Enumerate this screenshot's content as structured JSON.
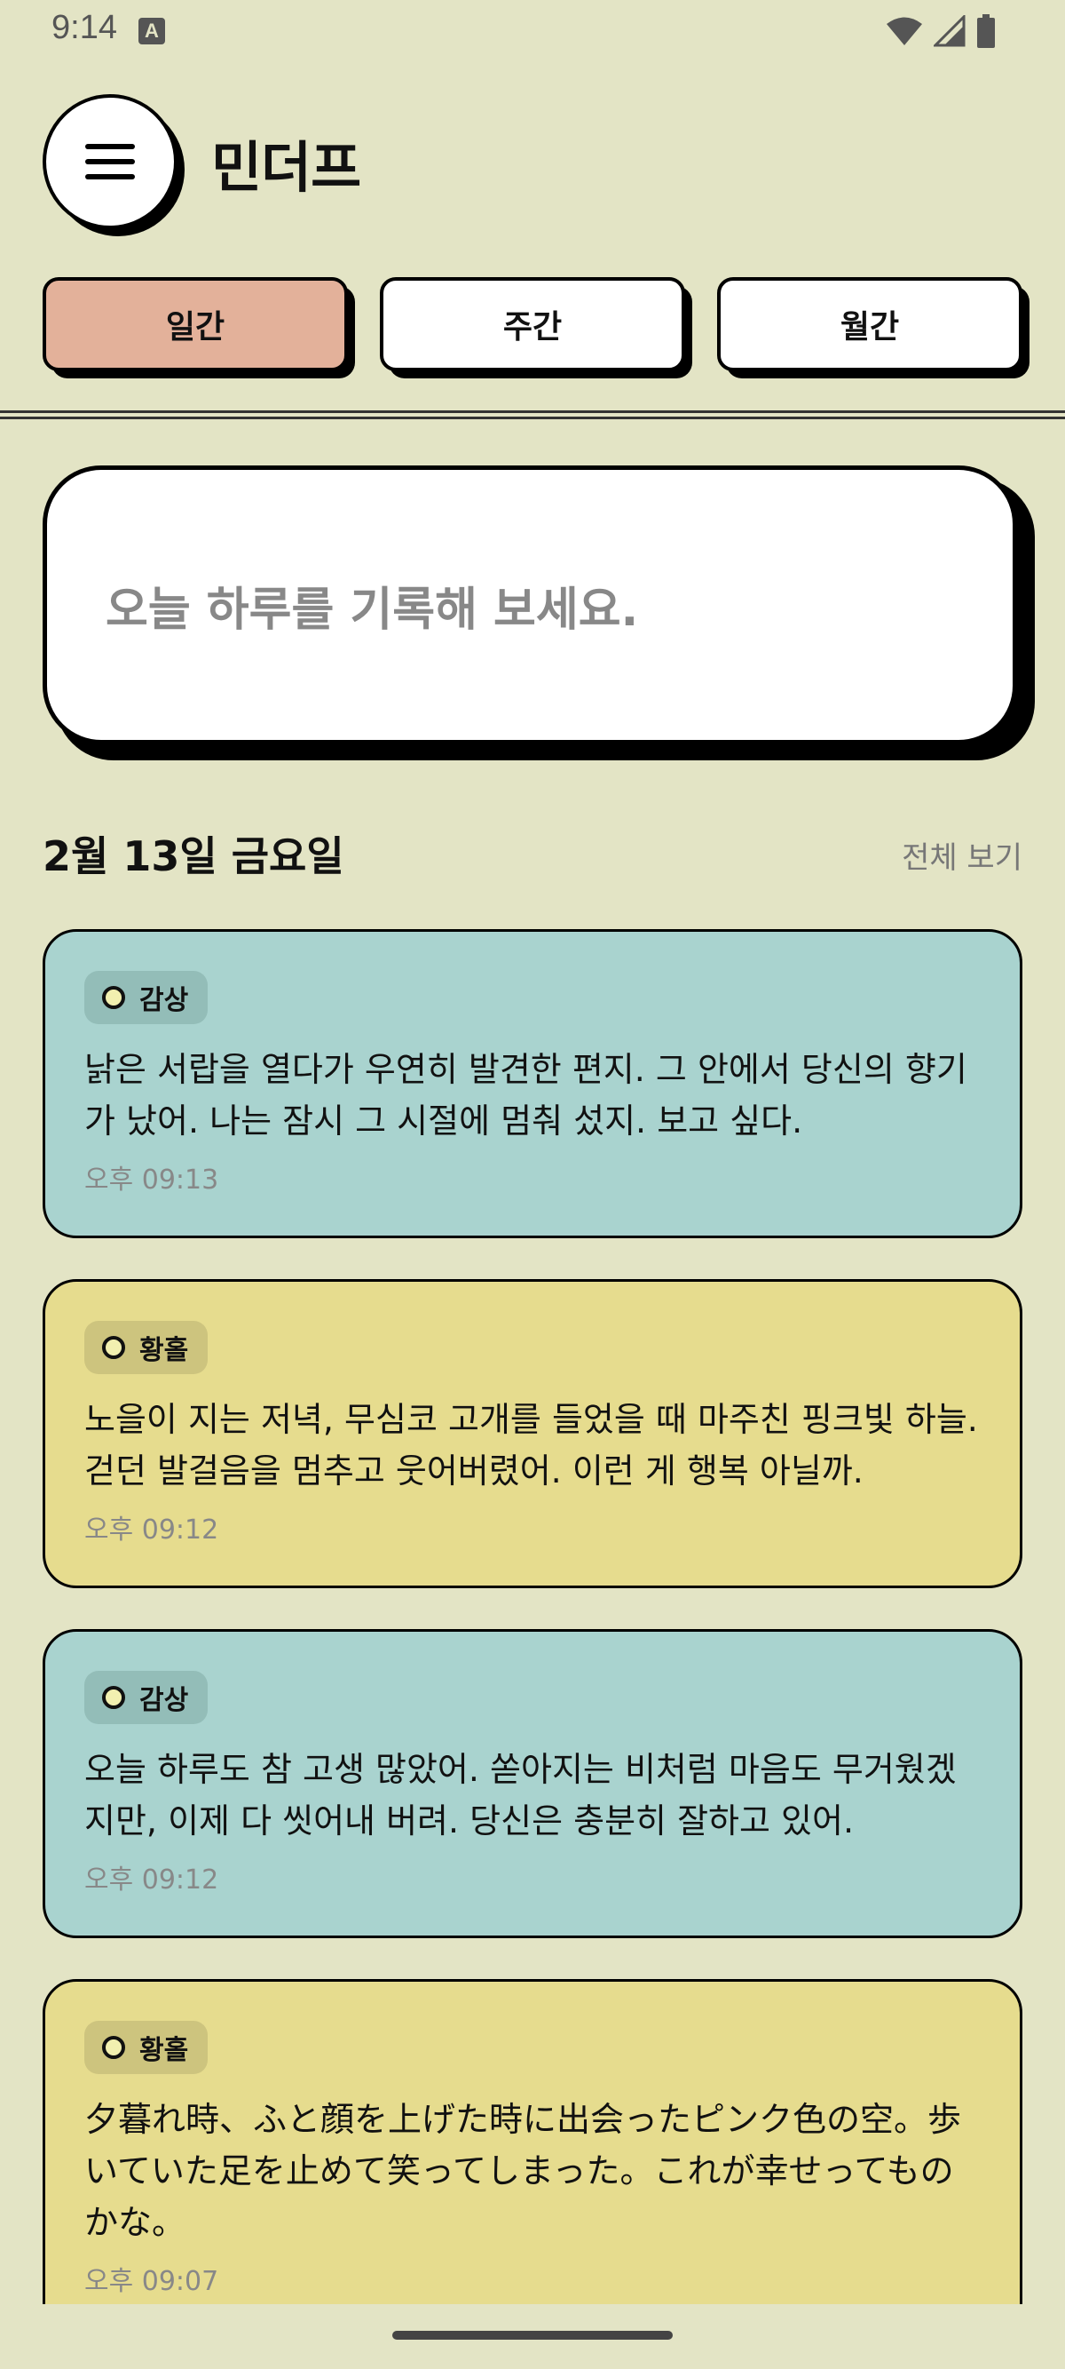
{
  "status_bar": {
    "time": "9:14",
    "notification_badge": "A"
  },
  "header": {
    "title": "민더프"
  },
  "tabs": [
    {
      "label": "일간",
      "active": true
    },
    {
      "label": "주간",
      "active": false
    },
    {
      "label": "월간",
      "active": false
    }
  ],
  "record": {
    "placeholder": "오늘 하루를 기록해 보세요."
  },
  "section": {
    "date": "2월 13일 금요일",
    "view_all": "전체 보기"
  },
  "entries": [
    {
      "tag": "감상",
      "color": "blue",
      "text": "낡은 서랍을 열다가 우연히 발견한 편지. 그 안에서 당신의 향기가 났어. 나는 잠시 그 시절에 멈춰 섰지. 보고 싶다.",
      "time": "오후 09:13"
    },
    {
      "tag": "황홀",
      "color": "yellow",
      "text": "노을이 지는 저녁, 무심코 고개를 들었을 때 마주친 핑크빛 하늘. 걷던 발걸음을 멈추고 웃어버렸어. 이런 게 행복 아닐까.",
      "time": "오후 09:12"
    },
    {
      "tag": "감상",
      "color": "blue",
      "text": "오늘 하루도 참 고생 많았어. 쏟아지는 비처럼 마음도 무거웠겠지만, 이제 다 씻어내 버려. 당신은 충분히 잘하고 있어.",
      "time": "오후 09:12"
    },
    {
      "tag": "황홀",
      "color": "yellow",
      "text": "夕暮れ時、ふと顔を上げた時に出会ったピンク色の空。歩いていた足を止めて笑ってしまった。これが幸せってものかな。",
      "time": "오후 09:07"
    }
  ],
  "colors": {
    "background": "#e3e4c5",
    "active_tab": "#e3b19a",
    "card_blue": "#a9d3cf",
    "card_yellow": "#e6dc8e"
  }
}
